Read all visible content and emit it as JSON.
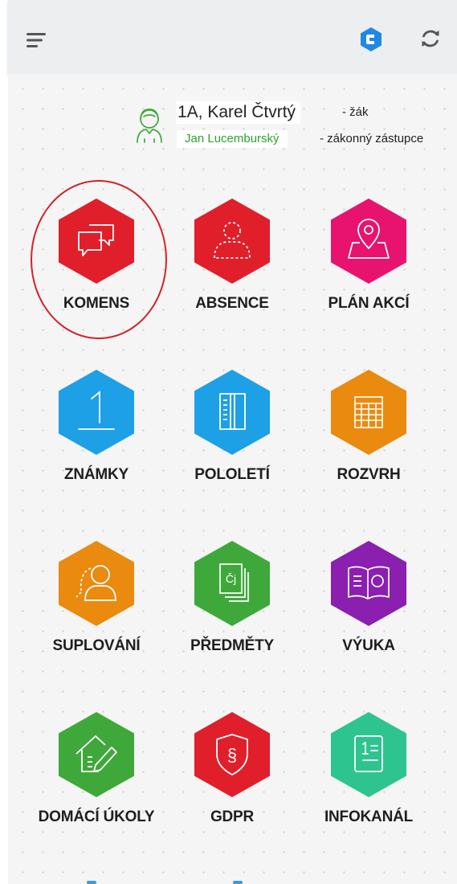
{
  "header": {
    "menu_icon": "hamburger-menu-icon",
    "logo_icon": "bakalari-logo-icon",
    "refresh_icon": "refresh-icon",
    "accent_color": "#1e88e5"
  },
  "user": {
    "avatar_icon": "student-avatar-icon",
    "class_and_name": "1A, Karel Čtvrtý",
    "role": "- žák",
    "guardian_name": "Jan Lucemburský",
    "guardian_role": "- zákonný zástupce",
    "guardian_color": "#2ba32b"
  },
  "modules": [
    {
      "label": "KOMENS",
      "icon": "chat-bubbles-icon",
      "color": "#e01f2b"
    },
    {
      "label": "ABSENCE",
      "icon": "absent-person-icon",
      "color": "#e01f2b"
    },
    {
      "label": "PLÁN AKCÍ",
      "icon": "map-pin-icon",
      "color": "#e8136f"
    },
    {
      "label": "ZNÁMKY",
      "icon": "grade-one-icon",
      "color": "#1ea0e6"
    },
    {
      "label": "POLOLETÍ",
      "icon": "report-book-icon",
      "color": "#1ea0e6"
    },
    {
      "label": "ROZVRH",
      "icon": "timetable-grid-icon",
      "color": "#ea8a0e"
    },
    {
      "label": "SUPLOVÁNÍ",
      "icon": "substitute-person-icon",
      "color": "#ea8a0e"
    },
    {
      "label": "PŘEDMĚTY",
      "icon": "subject-pages-icon",
      "color": "#3fa83a",
      "icon_text": "Čj"
    },
    {
      "label": "VÝUKA",
      "icon": "open-book-icon",
      "color": "#8a1fb0"
    },
    {
      "label": "DOMÁCÍ ÚKOLY",
      "icon": "house-pencil-icon",
      "color": "#3fa83a"
    },
    {
      "label": "GDPR",
      "icon": "shield-paragraph-icon",
      "color": "#e01f2b",
      "icon_text": "§"
    },
    {
      "label": "INFOKANÁL",
      "icon": "info-list-icon",
      "color": "#2ec48f"
    }
  ]
}
